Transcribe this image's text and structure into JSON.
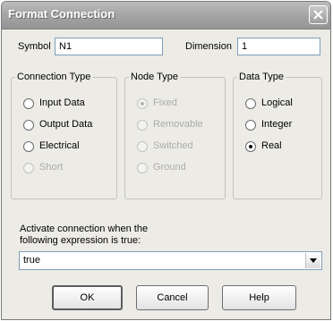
{
  "window": {
    "title": "Format Connection"
  },
  "symbol": {
    "label": "Symbol",
    "value": "N1"
  },
  "dimension": {
    "label": "Dimension",
    "value": "1"
  },
  "connection_type": {
    "legend": "Connection Type",
    "options": [
      {
        "label": "Input Data",
        "checked": false,
        "enabled": true
      },
      {
        "label": "Output Data",
        "checked": false,
        "enabled": true
      },
      {
        "label": "Electrical",
        "checked": false,
        "enabled": true
      },
      {
        "label": "Short",
        "checked": false,
        "enabled": false
      }
    ]
  },
  "node_type": {
    "legend": "Node Type",
    "options": [
      {
        "label": "Fixed",
        "checked": true,
        "enabled": false
      },
      {
        "label": "Removable",
        "checked": false,
        "enabled": false
      },
      {
        "label": "Switched",
        "checked": false,
        "enabled": false
      },
      {
        "label": "Ground",
        "checked": false,
        "enabled": false
      }
    ]
  },
  "data_type": {
    "legend": "Data Type",
    "options": [
      {
        "label": "Logical",
        "checked": false,
        "enabled": true
      },
      {
        "label": "Integer",
        "checked": false,
        "enabled": true
      },
      {
        "label": "Real",
        "checked": true,
        "enabled": true
      }
    ]
  },
  "expression": {
    "label_line1": "Activate connection when the",
    "label_line2": "following expression is true:",
    "value": "true"
  },
  "buttons": {
    "ok": "OK",
    "cancel": "Cancel",
    "help": "Help"
  }
}
